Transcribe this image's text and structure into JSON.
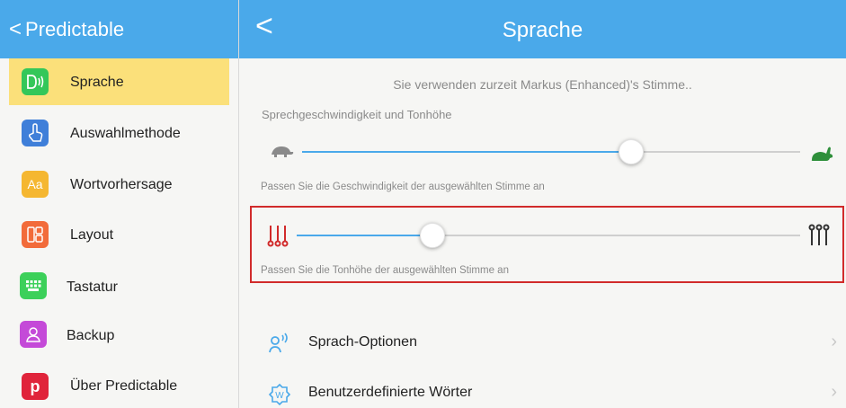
{
  "sidebar_header": {
    "back_glyph": "<",
    "title": "Predictable"
  },
  "main_header": {
    "back_glyph": "<",
    "title": "Sprache"
  },
  "sidebar": {
    "items": [
      {
        "label": "Sprache",
        "icon": "speech-icon",
        "icon_color": "#34c759",
        "active": true
      },
      {
        "label": "Auswahlmethode",
        "icon": "hand-pointer-icon",
        "icon_color": "#3f7fd9"
      },
      {
        "label": "Wortvorhersage",
        "icon": "aa-text-icon",
        "icon_color": "#f5b731",
        "icon_text": "Aa"
      },
      {
        "label": "Layout",
        "icon": "layout-icon",
        "icon_color": "#f26b3a"
      },
      {
        "label": "Tastatur",
        "icon": "keyboard-icon",
        "icon_color": "#3cd05a"
      },
      {
        "label": "Backup",
        "icon": "user-backup-icon",
        "icon_color": "#c44ad8"
      },
      {
        "label": "Über Predictable",
        "icon": "predictable-logo-icon",
        "icon_color": "#e0243b",
        "icon_text": "p"
      }
    ]
  },
  "main": {
    "voice_info": "Sie verwenden zurzeit Markus (Enhanced)'s Stimme..",
    "speed_pitch_label": "Sprechgeschwindigkeit und Tonhöhe",
    "speed_slider": {
      "value": 0.66,
      "min_icon": "turtle-icon",
      "max_icon": "rabbit-icon"
    },
    "speed_hint": "Passen Sie die Geschwindigkeit der ausgewählten Stimme an",
    "pitch_slider": {
      "value": 0.27,
      "min_icon": "pitch-low-icon",
      "max_icon": "pitch-high-icon"
    },
    "pitch_hint": "Passen Sie die Tonhöhe der ausgewählten Stimme an",
    "rows": [
      {
        "label": "Sprach-Optionen",
        "icon": "speech-options-icon"
      },
      {
        "label": "Benutzerdefinierte Wörter",
        "icon": "custom-words-icon"
      }
    ]
  },
  "colors": {
    "accent": "#4aa9ea",
    "active_bg": "#fbe07a",
    "highlight_border": "#d12b2b"
  }
}
